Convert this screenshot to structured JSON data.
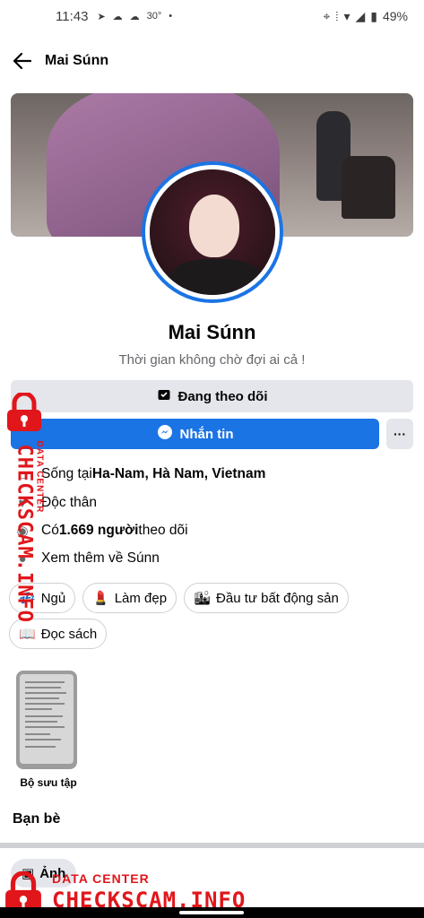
{
  "status_bar": {
    "time": "11:43",
    "temperature": "30°",
    "battery": "49%"
  },
  "header": {
    "title": "Mai Súnn"
  },
  "profile": {
    "name": "Mai Súnn",
    "bio": "Thời gian không chờ đợi ai cả !",
    "following_label": "Đang theo dõi",
    "message_label": "Nhắn tin",
    "more_label": "···"
  },
  "info": {
    "lives_prefix": "Sống tại ",
    "lives_place": "Ha-Nam, Hà Nam, Vietnam",
    "relationship": "Độc thân",
    "followers_prefix": "Có ",
    "followers_count": "1.669 người",
    "followers_suffix": " theo dõi",
    "see_more": "Xem thêm về Súnn"
  },
  "hobbies": [
    {
      "icon": "💤",
      "label": "Ngủ"
    },
    {
      "icon": "💄",
      "label": "Làm đẹp"
    },
    {
      "icon": "🏙",
      "label": "Đầu tư bất động sản"
    },
    {
      "icon": "📖",
      "label": "Đọc sách"
    }
  ],
  "collection": {
    "label": "Bộ sưu tập"
  },
  "friends": {
    "title": "Bạn bè"
  },
  "photos_tab": {
    "label": "Ảnh"
  },
  "watermark": {
    "small": "DATA CENTER",
    "big": "CHECKSCAM.INFO"
  },
  "colors": {
    "accent": "#1b74e4",
    "button_gray": "#e4e6eb",
    "watermark_red": "#e0161b"
  }
}
